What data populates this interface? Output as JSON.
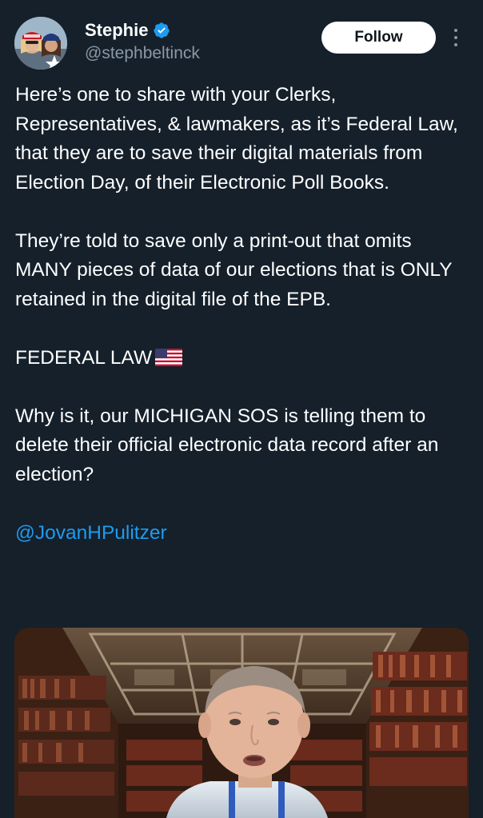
{
  "author": {
    "display_name": "Stephie",
    "handle": "@stephbeltinck",
    "avatar_icon": "profile-photo",
    "verified_icon": "verified-badge-icon",
    "verified_color": "#1d9bf0"
  },
  "actions": {
    "follow_label": "Follow",
    "more_icon": "vertical-ellipsis-icon"
  },
  "tweet": {
    "p1": "Here’s one to share with your Clerks, Representatives,  & lawmakers, as it’s Federal Law, that they are to save their digital materials from Election Day, of their Electronic Poll Books.",
    "p2": "They’re told to save only a print-out that omits MANY pieces of data of our elections that is ONLY retained in the digital file of the EPB.",
    "p3": "FEDERAL LAW",
    "p3_emoji": "us-flag-emoji",
    "p4": "Why is it, our MICHIGAN SOS is telling them to delete their official electronic data record after an election?",
    "mention": "@JovanHPulitzer"
  },
  "media": {
    "type": "video-thumbnail",
    "subject": "man-in-library-background"
  },
  "colors": {
    "background": "#15202b",
    "text": "#ffffff",
    "secondary_text": "#8b98a5",
    "link": "#1d9bf0",
    "button_bg": "#ffffff",
    "button_text": "#0f1419"
  }
}
